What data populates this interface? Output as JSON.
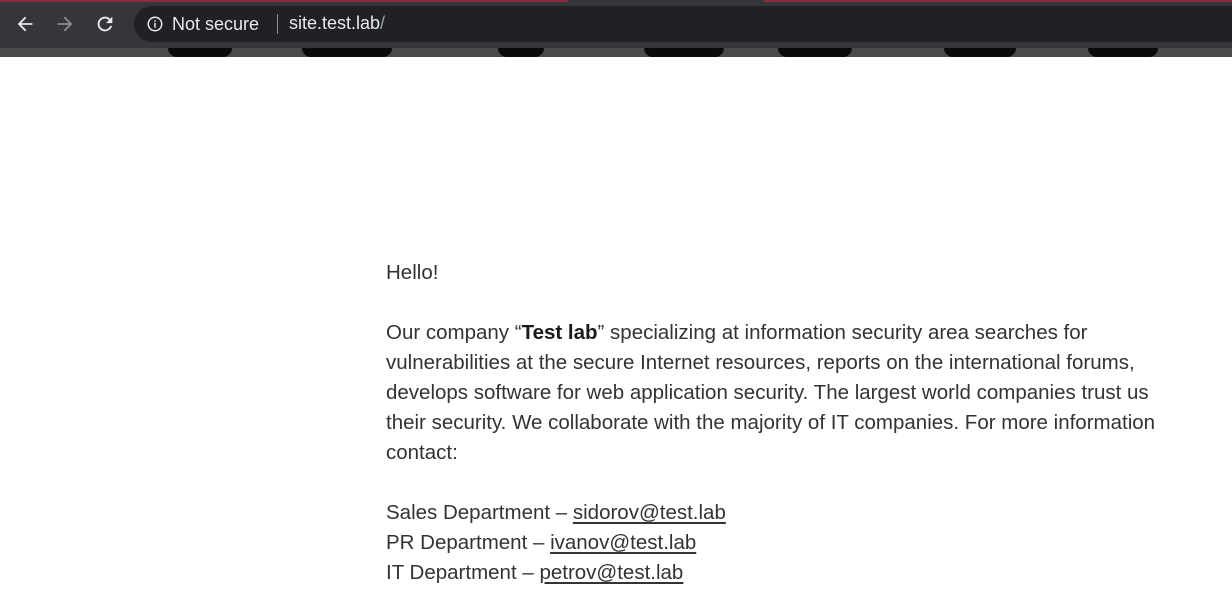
{
  "browser": {
    "back_icon": "arrow-left-icon",
    "forward_icon": "arrow-right-icon",
    "reload_icon": "reload-icon",
    "security_icon": "info-circle-icon",
    "security_label": "Not secure",
    "url_host": "site.test.lab",
    "url_path": "/"
  },
  "page": {
    "greeting": "Hello!",
    "intro_prefix": "Our company “",
    "company_name": "Test lab",
    "intro_suffix": "” specializing at information security area searches for vulnerabilities at the secure Internet resources, reports on the international forums, develops software for web application security. The largest world companies trust us their security. We collaborate with the majority of IT companies. For more information contact:",
    "contacts": [
      {
        "label": "Sales Department – ",
        "email": " sidorov@test.lab"
      },
      {
        "label": "PR Department – ",
        "email": " ivanov@test.lab"
      },
      {
        "label": "IT Department – ",
        "email": " petrov@test.lab"
      }
    ]
  }
}
